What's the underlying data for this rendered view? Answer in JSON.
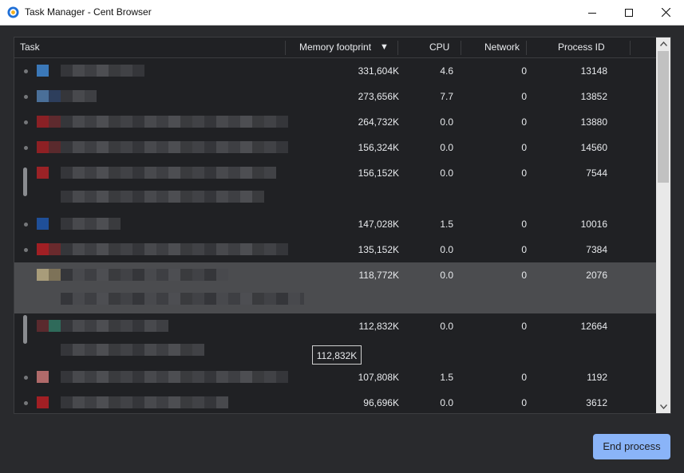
{
  "window": {
    "title": "Task Manager - Cent Browser"
  },
  "columns": [
    "Task",
    "Memory footprint",
    "CPU",
    "Network",
    "Process ID"
  ],
  "sort_indicator": "▼",
  "rows": [
    {
      "memory": "331,604K",
      "cpu": "4.6",
      "network": "0",
      "pid": "13148",
      "favicon": "#3b78b8",
      "sub_favicon": ""
    },
    {
      "memory": "273,656K",
      "cpu": "7.7",
      "network": "0",
      "pid": "13852",
      "favicon": "#4a6f98",
      "sub_favicon": "#2d3e5c"
    },
    {
      "memory": "264,732K",
      "cpu": "0.0",
      "network": "0",
      "pid": "13880",
      "favicon": "#8a2025",
      "sub_favicon": "#5e2a2e"
    },
    {
      "memory": "156,324K",
      "cpu": "0.0",
      "network": "0",
      "pid": "14560",
      "favicon": "#8e2024",
      "sub_favicon": "#5a2a2d"
    },
    {
      "memory": "156,152K",
      "cpu": "0.0",
      "network": "0",
      "pid": "7544",
      "favicon": "#9a2226",
      "sub_favicon": ""
    },
    {
      "memory": "147,028K",
      "cpu": "1.5",
      "network": "0",
      "pid": "10016",
      "favicon": "#1f4f98",
      "sub_favicon": ""
    },
    {
      "memory": "135,152K",
      "cpu": "0.0",
      "network": "0",
      "pid": "7384",
      "favicon": "#a11f24",
      "sub_favicon": "#6a2a2d"
    },
    {
      "memory": "118,772K",
      "cpu": "0.0",
      "network": "0",
      "pid": "2076",
      "favicon": "#a89c7a",
      "sub_favicon": "#7d7258"
    },
    {
      "memory": "112,832K",
      "cpu": "0.0",
      "network": "0",
      "pid": "12664",
      "favicon": "#5a2a2e",
      "sub_favicon": "#2f6a5a"
    },
    {
      "memory": "107,808K",
      "cpu": "1.5",
      "network": "0",
      "pid": "1192",
      "favicon": "#b06a6a",
      "sub_favicon": ""
    },
    {
      "memory": "96,696K",
      "cpu": "0.0",
      "network": "0",
      "pid": "3612",
      "favicon": "#a11f24",
      "sub_favicon": ""
    }
  ],
  "tooltip": "112,832K",
  "end_process_label": "End process"
}
